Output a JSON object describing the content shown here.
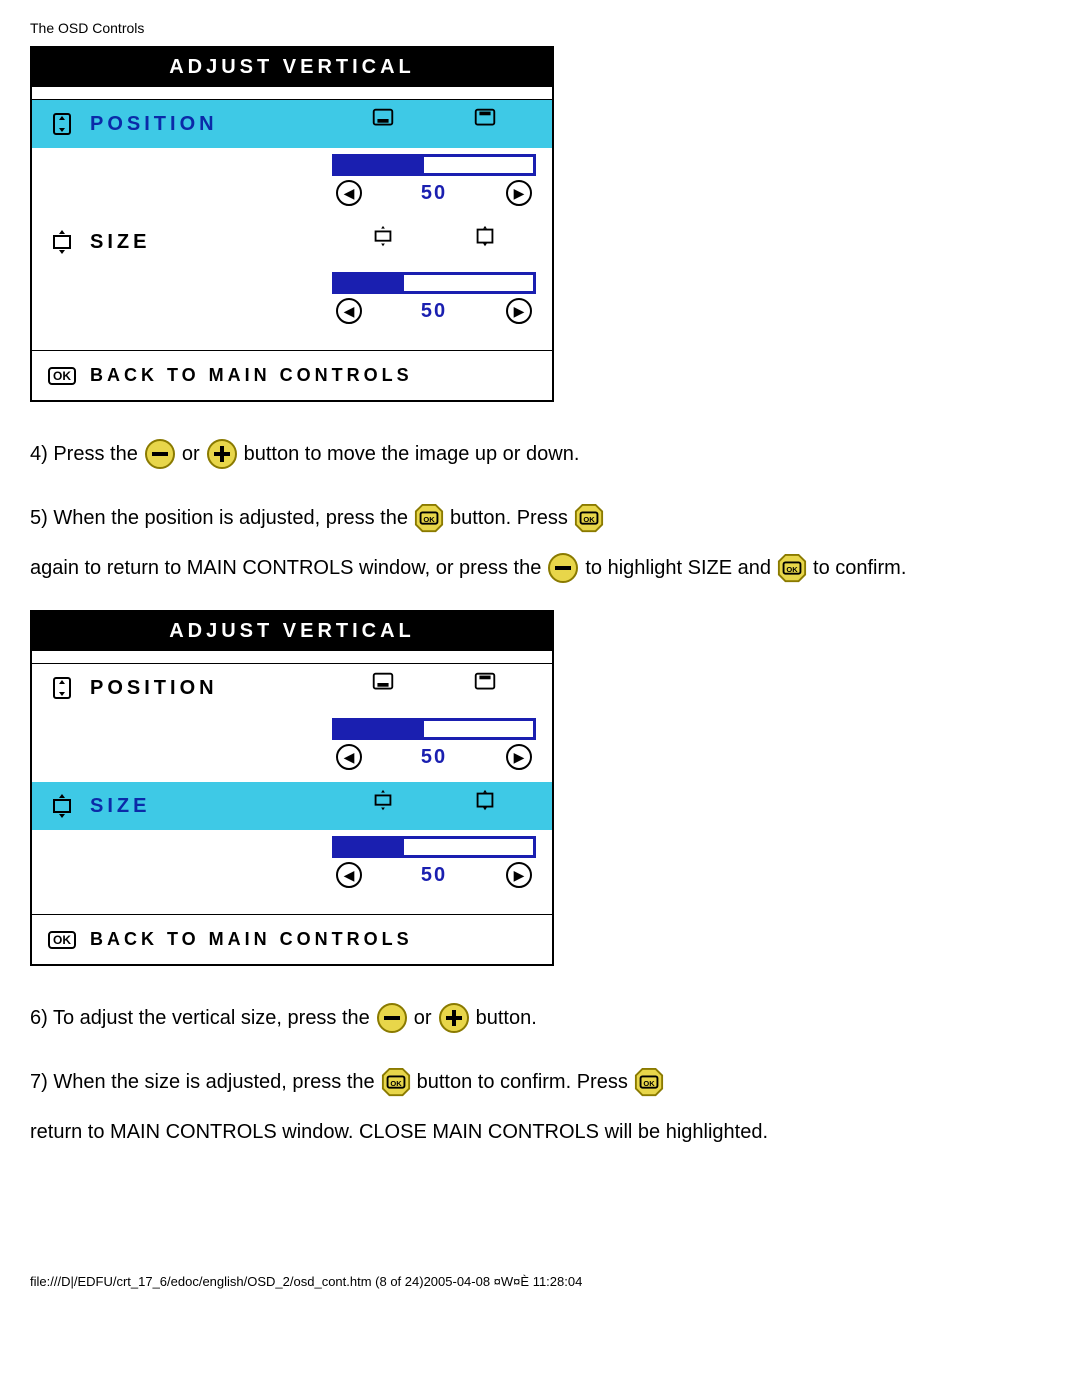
{
  "header": {
    "title": "The OSD Controls"
  },
  "panel1": {
    "title": "ADJUST VERTICAL",
    "position": {
      "label": "POSITION",
      "value": "50",
      "fill": 45,
      "selected": true
    },
    "size": {
      "label": "SIZE",
      "value": "50",
      "fill": 35,
      "selected": false
    },
    "back": {
      "label": "BACK TO MAIN CONTROLS"
    }
  },
  "panel2": {
    "title": "ADJUST VERTICAL",
    "position": {
      "label": "POSITION",
      "value": "50",
      "fill": 45,
      "selected": false
    },
    "size": {
      "label": "SIZE",
      "value": "50",
      "fill": 35,
      "selected": true
    },
    "back": {
      "label": "BACK TO MAIN CONTROLS"
    }
  },
  "steps": {
    "s4a": "4) Press the",
    "s4b": "or",
    "s4c": "button to move the image up or down.",
    "s5a": "5) When the position is adjusted, press the",
    "s5b": "button. Press",
    "s5c": "again to return to MAIN CONTROLS window, or press the",
    "s5d": "to highlight SIZE and",
    "s5e": "to confirm.",
    "s6a": "6) To adjust the vertical size, press the",
    "s6b": "or",
    "s6c": "button.",
    "s7a": "7) When the size is adjusted, press the",
    "s7b": "button to confirm. Press",
    "s7c": "return to MAIN CONTROLS window. CLOSE MAIN CONTROLS will be highlighted."
  },
  "footer": {
    "text": "file:///D|/EDFU/crt_17_6/edoc/english/OSD_2/osd_cont.htm (8 of 24)2005-04-08 ¤W¤È 11:28:04"
  }
}
